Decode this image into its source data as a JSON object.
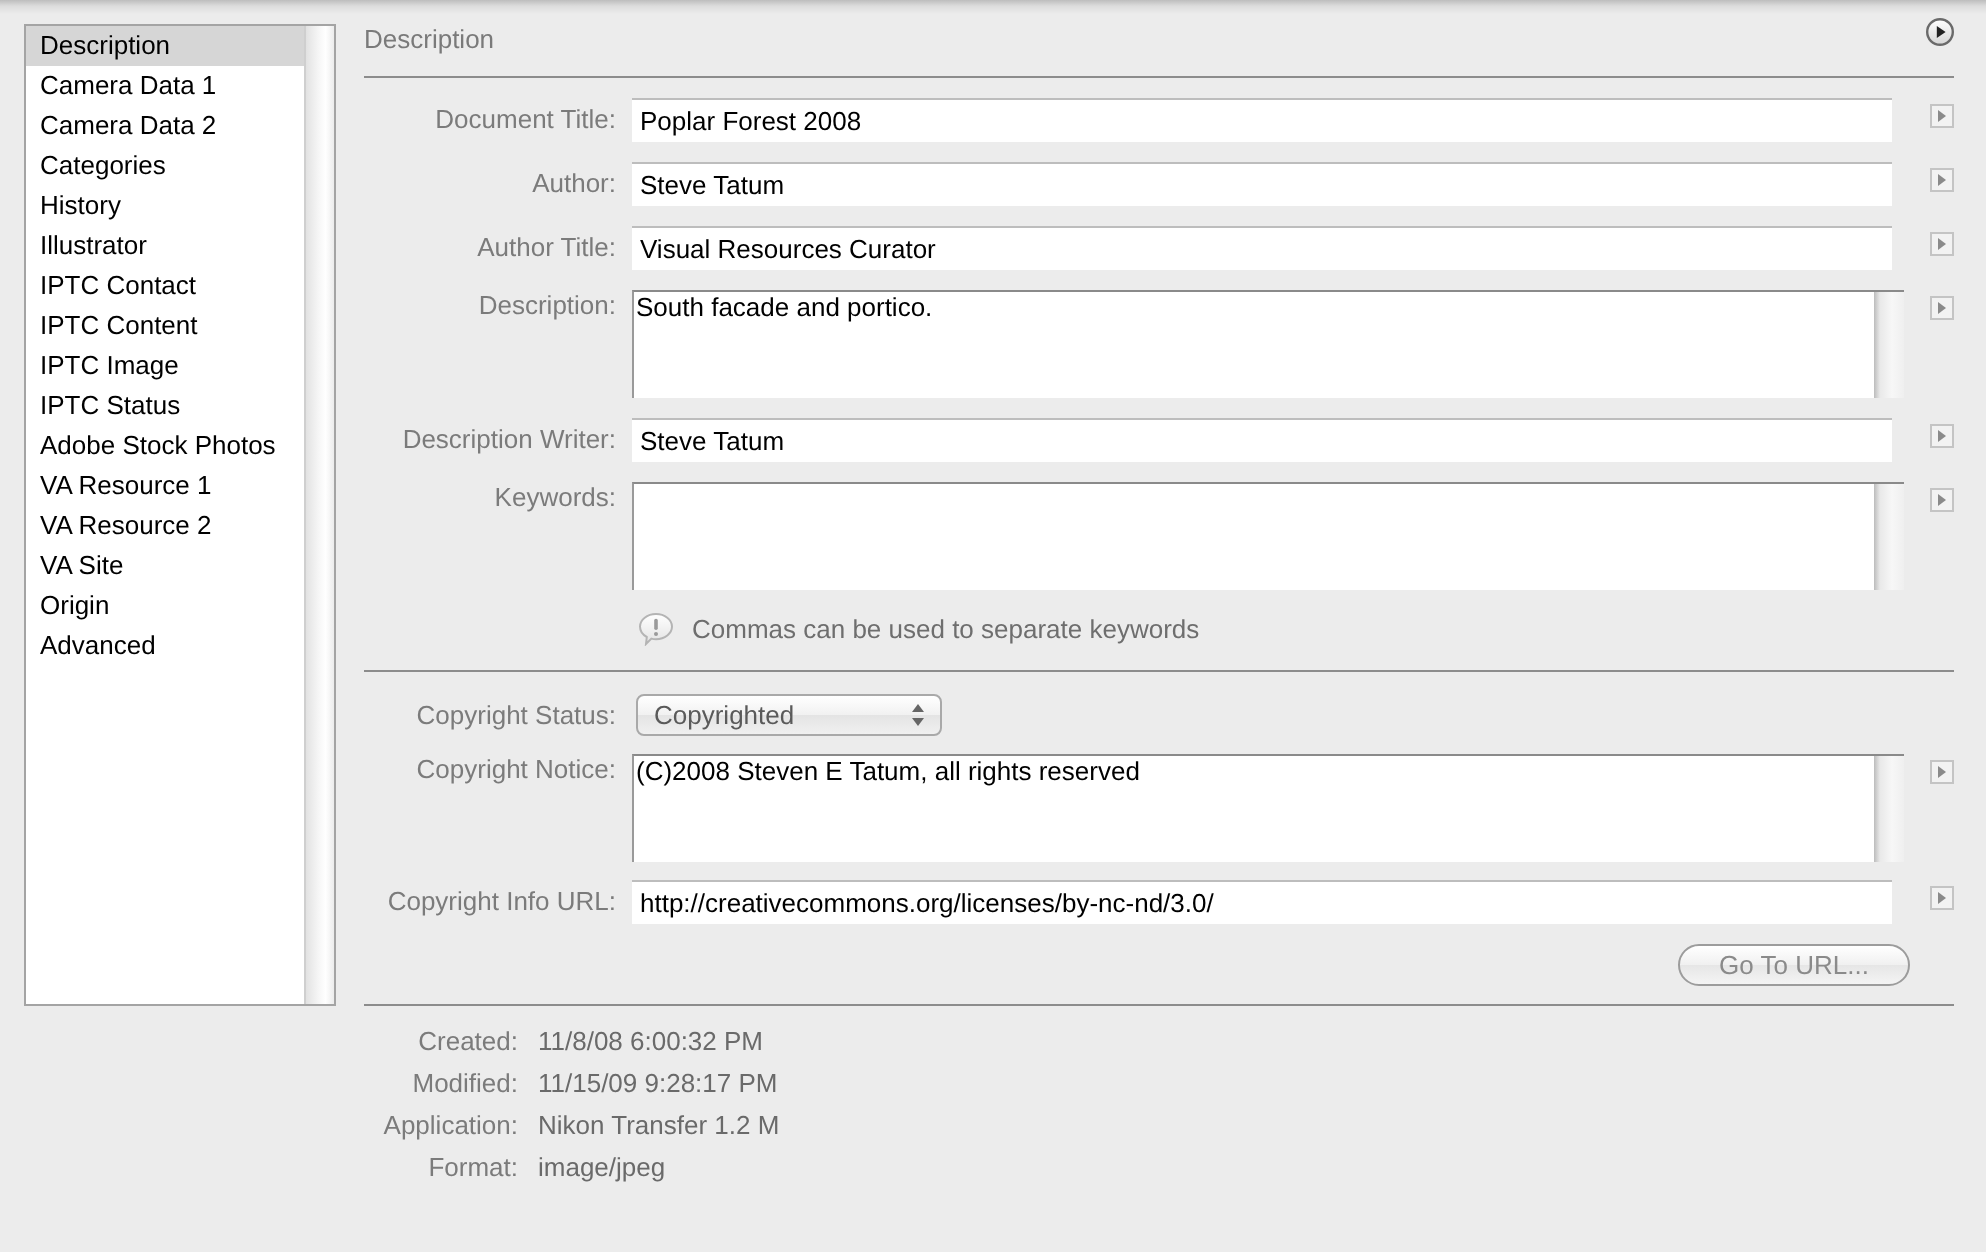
{
  "sidebar": {
    "items": [
      {
        "label": "Description",
        "selected": true
      },
      {
        "label": "Camera Data 1",
        "selected": false
      },
      {
        "label": "Camera Data 2",
        "selected": false
      },
      {
        "label": "Categories",
        "selected": false
      },
      {
        "label": "History",
        "selected": false
      },
      {
        "label": "Illustrator",
        "selected": false
      },
      {
        "label": "IPTC Contact",
        "selected": false
      },
      {
        "label": "IPTC Content",
        "selected": false
      },
      {
        "label": "IPTC Image",
        "selected": false
      },
      {
        "label": "IPTC Status",
        "selected": false
      },
      {
        "label": "Adobe Stock Photos",
        "selected": false
      },
      {
        "label": "VA Resource 1",
        "selected": false
      },
      {
        "label": "VA Resource 2",
        "selected": false
      },
      {
        "label": "VA Site",
        "selected": false
      },
      {
        "label": "Origin",
        "selected": false
      },
      {
        "label": "Advanced",
        "selected": false
      }
    ]
  },
  "panel": {
    "title": "Description"
  },
  "description_fields": [
    {
      "kind": "text",
      "label": "Document Title:",
      "value": "Poplar Forest 2008"
    },
    {
      "kind": "text",
      "label": "Author:",
      "value": "Steve Tatum"
    },
    {
      "kind": "text",
      "label": "Author Title:",
      "value": "Visual Resources Curator"
    },
    {
      "kind": "textarea",
      "label": "Description:",
      "value": "South facade and portico."
    },
    {
      "kind": "text",
      "label": "Description Writer:",
      "value": "Steve Tatum"
    },
    {
      "kind": "textarea",
      "label": "Keywords:"
    }
  ],
  "keywords_hint": "Commas can be used to separate keywords",
  "copyright_fields": [
    {
      "kind": "select",
      "label": "Copyright Status:",
      "value": "Copyrighted"
    },
    {
      "kind": "textarea",
      "label": "Copyright Notice:",
      "value": "(C)2008 Steven E Tatum, all rights reserved"
    },
    {
      "kind": "text",
      "label": "Copyright Info URL:",
      "value": "http://creativecommons.org/licenses/by-nc-nd/3.0/"
    }
  ],
  "url_button": {
    "label": "Go To URL...",
    "disabled": true
  },
  "file_info": [
    {
      "label": "Created:",
      "value": "11/8/08 6:00:32 PM"
    },
    {
      "label": "Modified:",
      "value": "11/15/09 9:28:17 PM"
    },
    {
      "label": "Application:",
      "value": "Nikon Transfer 1.2 M"
    },
    {
      "label": "Format:",
      "value": "image/jpeg"
    }
  ]
}
